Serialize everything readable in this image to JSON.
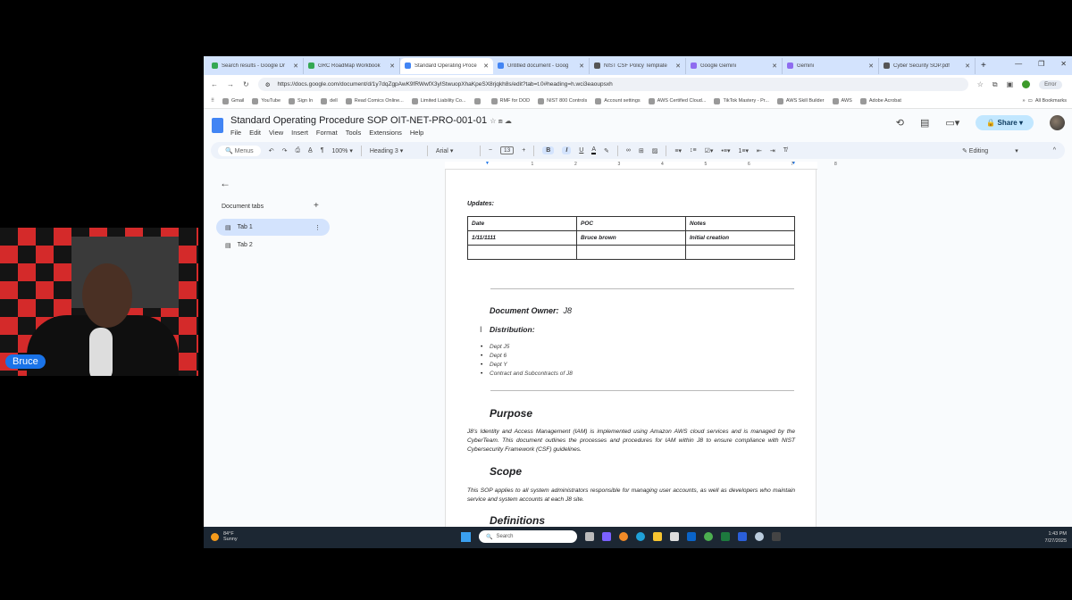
{
  "browser": {
    "tabs": [
      {
        "title": "Search results - Google Dr",
        "color": "#34a853"
      },
      {
        "title": "GRC RoadMap Workbook",
        "color": "#34a853"
      },
      {
        "title": "Standard Operating Proce",
        "color": "#4285f4",
        "active": true
      },
      {
        "title": "Untitled document - Goog",
        "color": "#4285f4"
      },
      {
        "title": "NIST CSF Policy Template",
        "color": "#555555"
      },
      {
        "title": "Google Gemini",
        "color": "#8e6cf0"
      },
      {
        "title": "Gemini",
        "color": "#8e6cf0"
      },
      {
        "title": "Cyber Security SOP.pdf",
        "color": "#555555"
      }
    ],
    "url": "https://docs.google.com/document/d/1y7dqZgpAwK9fRWwfX3yIStwuopXhaKpeSX8rjqkh8s/edit?tab=t.0#heading=h.wci3eaoupsxh",
    "profile_status": "Error",
    "bookmarks": [
      "Gmail",
      "YouTube",
      "Sign In",
      "dell",
      "Read Comics Online...",
      "Limited Liability Co...",
      "",
      "RMF for DOD",
      "NIST 800 Controls",
      "Account settings",
      "AWS Certified Cloud...",
      "TikTok Mastery - Pr...",
      "AWS Skill Builder",
      "AWS",
      "Adobe Acrobat"
    ],
    "all_bookmarks": "All Bookmarks"
  },
  "doc": {
    "title": "Standard Operating Procedure SOP OIT-NET-PRO-001-01",
    "menus": [
      "File",
      "Edit",
      "View",
      "Insert",
      "Format",
      "Tools",
      "Extensions",
      "Help"
    ],
    "share_label": "Share",
    "toolbar": {
      "search": "Menus",
      "zoom": "100%",
      "style": "Heading 3",
      "font": "Arial",
      "font_size": "13",
      "mode": "Editing"
    },
    "sidebar": {
      "title": "Document tabs",
      "tabs": [
        "Tab 1",
        "Tab 2"
      ]
    },
    "updates_label": "Updates:",
    "table": {
      "headers": [
        "Date",
        "POC",
        "Notes"
      ],
      "rows": [
        [
          "1/11/1111",
          "Bruce brown",
          "Initial creation"
        ],
        [
          "",
          "",
          ""
        ]
      ]
    },
    "owner_label": "Document Owner:",
    "owner_value": "J8",
    "distribution_label": "Distribution:",
    "distribution": [
      "Dept J5",
      "Dept 6",
      "Dept Y",
      "Contract and Subcontracts of J8"
    ],
    "purpose_heading": "Purpose",
    "purpose_text": "J8's Identity and Access Management (IAM) is implemented using Amazon AWS cloud services and is managed by the CyberTeam. This document outlines the processes and procedures for IAM within J8 to ensure compliance with NIST Cybersecurity Framework (CSF) guidelines.",
    "scope_heading": "Scope",
    "scope_text": "This SOP applies to all system administrators responsible for managing user accounts, as well as developers who maintain service and system accounts at each J8 site.",
    "definitions_heading": "Definitions"
  },
  "taskbar": {
    "temp": "84°F",
    "weather": "Sunny",
    "search": "Search",
    "time": "1:43 PM",
    "date": "7/27/2025"
  },
  "participant": {
    "name": "Bruce"
  }
}
